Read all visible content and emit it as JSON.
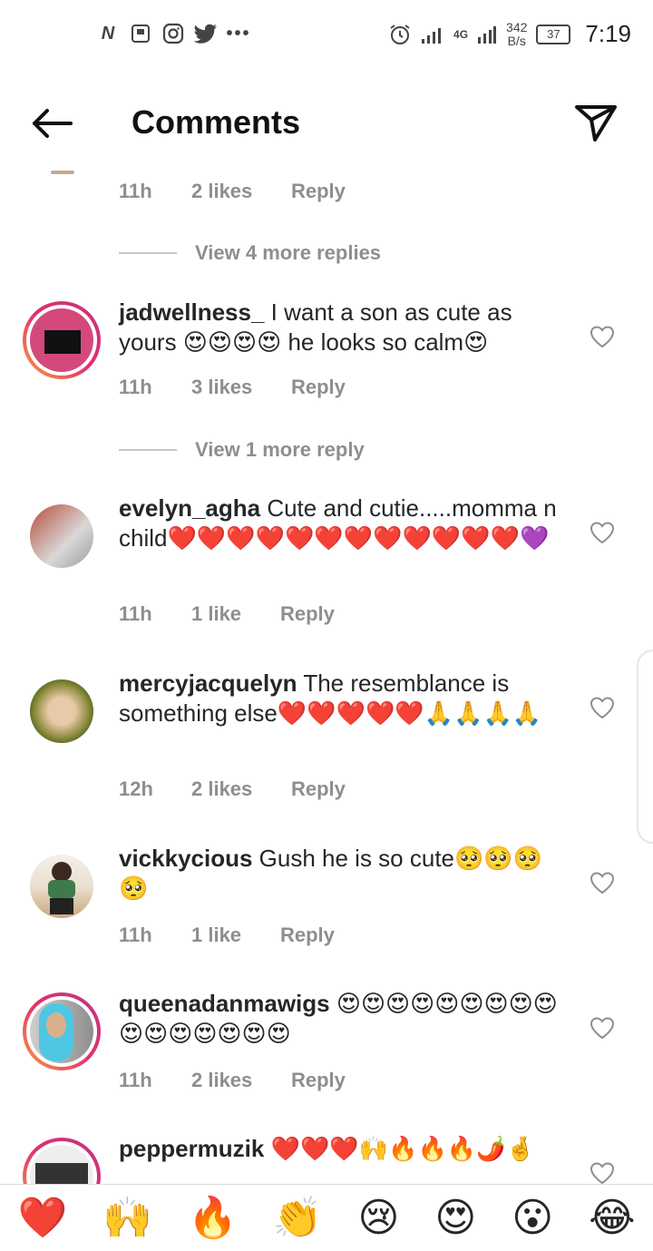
{
  "status_bar": {
    "left_icons": [
      "netflix-icon",
      "gallery-icon",
      "instagram-icon",
      "twitter-icon",
      "more-dots-icon"
    ],
    "network": "4G",
    "speed_value": "342",
    "speed_unit": "B/s",
    "battery": "37",
    "time": "7:19"
  },
  "header": {
    "title": "Comments"
  },
  "top_meta": {
    "time": "11h",
    "likes": "2 likes",
    "reply": "Reply"
  },
  "view_more_1": "View 4 more replies",
  "view_more_2": "View 1 more reply",
  "comments": [
    {
      "username": "jadwellness_",
      "text": " I want a son as cute as yours 😍😍😍😍 he looks so calm😍",
      "time": "11h",
      "likes": "3 likes",
      "reply": "Reply",
      "has_story_ring": true
    },
    {
      "username": "evelyn_agha",
      "text": " Cute and cutie.....momma n child❤️❤️❤️❤️❤️❤️❤️❤️❤️❤️❤️❤️💜",
      "time": "11h",
      "likes": "1 like",
      "reply": "Reply",
      "has_story_ring": false
    },
    {
      "username": "mercyjacquelyn",
      "text": " The resemblance is something else❤️❤️❤️❤️❤️🙏🙏🙏🙏",
      "time": "12h",
      "likes": "2 likes",
      "reply": "Reply",
      "has_story_ring": false
    },
    {
      "username": "vickkycious",
      "text": " Gush he is so cute🥺🥺🥺🥺",
      "time": "11h",
      "likes": "1 like",
      "reply": "Reply",
      "has_story_ring": false
    },
    {
      "username": "queenadanmawigs",
      "text": " 😍😍😍😍😍😍😍😍😍😍😍😍😍😍😍😍",
      "time": "11h",
      "likes": "2 likes",
      "reply": "Reply",
      "has_story_ring": true
    },
    {
      "username": "peppermuzik",
      "text": " ❤️❤️❤️🙌🔥🔥🔥🌶️🤞",
      "time": "",
      "likes": "",
      "reply": "",
      "has_story_ring": true
    }
  ],
  "emoji_bar": [
    "❤️",
    "🙌",
    "🔥",
    "👏",
    "😢",
    "😍",
    "😮",
    "😂"
  ]
}
